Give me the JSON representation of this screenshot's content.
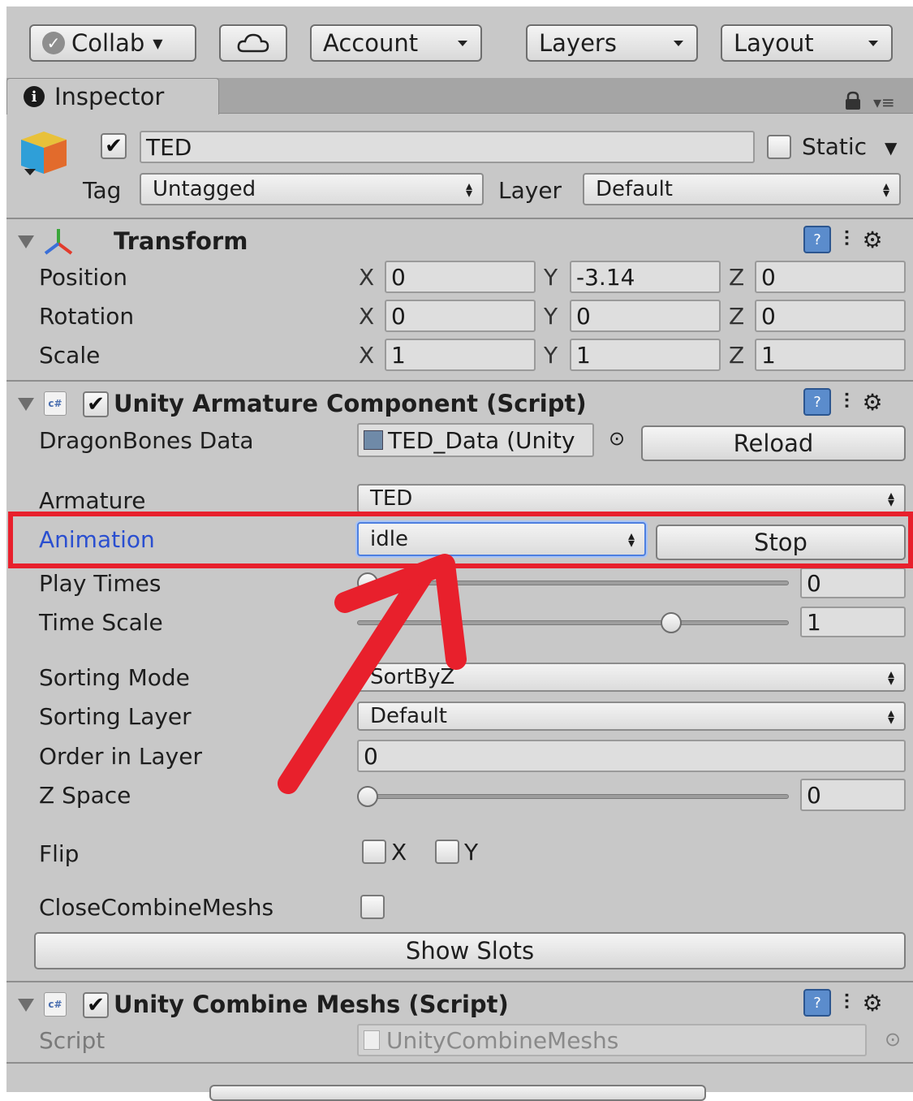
{
  "toolbar": {
    "collab": "Collab",
    "account": "Account",
    "layers": "Layers",
    "layout": "Layout"
  },
  "tab": {
    "inspector": "Inspector"
  },
  "object": {
    "name": "TED",
    "active": true,
    "static_label": "Static",
    "static": false,
    "tag_label": "Tag",
    "tag_value": "Untagged",
    "layer_label": "Layer",
    "layer_value": "Default"
  },
  "transform": {
    "title": "Transform",
    "rows": [
      {
        "label": "Position",
        "x": "0",
        "y": "-3.14",
        "z": "0"
      },
      {
        "label": "Rotation",
        "x": "0",
        "y": "0",
        "z": "0"
      },
      {
        "label": "Scale",
        "x": "1",
        "y": "1",
        "z": "1"
      }
    ],
    "axis_x": "X",
    "axis_y": "Y",
    "axis_z": "Z"
  },
  "armature": {
    "icon_text": "c#",
    "title": "Unity Armature Component (Script)",
    "dragonbones_label": "DragonBones Data",
    "dragonbones_value": "TED_Data (Unity",
    "reload": "Reload",
    "armature_label": "Armature",
    "armature_value": "TED",
    "animation_label": "Animation",
    "animation_value": "idle",
    "stop": "Stop",
    "play_times_label": "Play Times",
    "play_times_value": "0",
    "play_times_level": 0,
    "time_scale_label": "Time Scale",
    "time_scale_value": "1",
    "time_scale_level": 0.74,
    "sorting_mode_label": "Sorting Mode",
    "sorting_mode_value": "SortByZ",
    "sorting_layer_label": "Sorting Layer",
    "sorting_layer_value": "Default",
    "order_label": "Order in Layer",
    "order_value": "0",
    "zspace_label": "Z Space",
    "zspace_value": "0",
    "zspace_level": 0,
    "flip_label": "Flip",
    "flip_x": "X",
    "flip_y": "Y",
    "close_combine_label": "CloseCombineMeshs",
    "show_slots": "Show Slots"
  },
  "combine": {
    "icon_text": "c#",
    "title": "Unity Combine Meshs (Script)",
    "script_label": "Script",
    "script_value": "UnityCombineMeshs"
  },
  "colors": {
    "highlight": "#e8202c",
    "focused_label": "#2a4fd0"
  }
}
